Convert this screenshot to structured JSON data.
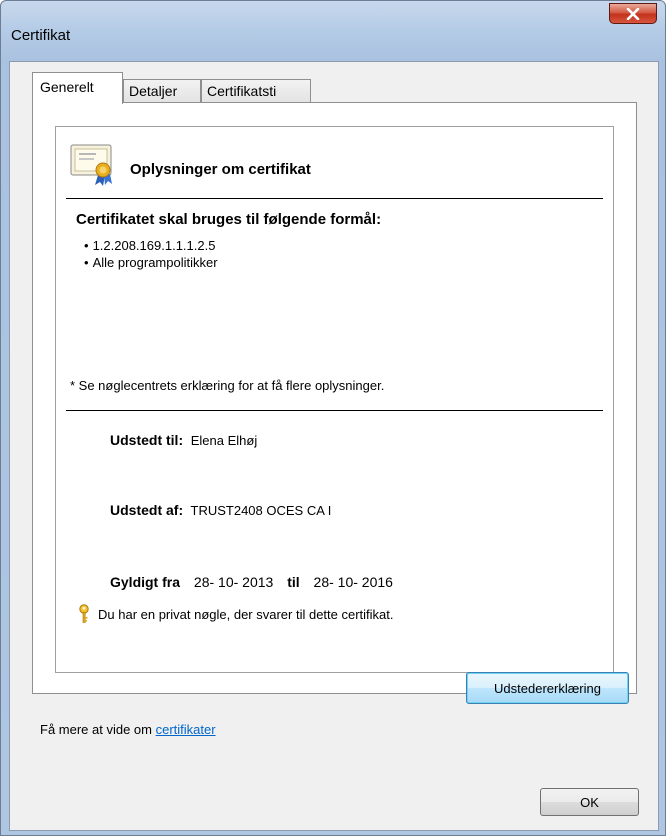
{
  "window": {
    "title": "Certifikat"
  },
  "tabs": [
    {
      "label": "Generelt",
      "active": true
    },
    {
      "label": "Detaljer",
      "active": false
    },
    {
      "label": "Certifikatsti",
      "active": false
    }
  ],
  "general": {
    "heading": "Oplysninger om certifikat",
    "purpose_title": "Certifikatet skal bruges til følgende formål:",
    "purposes": [
      "1.2.208.169.1.1.1.2.5",
      "Alle programpolitikker"
    ],
    "note": "* Se nøglecentrets erklæring for at få flere oplysninger.",
    "issued_to_label": "Udstedt til:",
    "issued_to_value": "Elena Elhøj",
    "issued_by_label": "Udstedt af:",
    "issued_by_value": "TRUST2408 OCES CA I",
    "valid_from_label": "Gyldigt fra",
    "valid_from_value": "28- 10- 2013",
    "valid_to_label": "til",
    "valid_to_value": "28- 10- 2016",
    "private_key_text": "Du har en privat nøgle, der svarer til dette certifikat."
  },
  "buttons": {
    "issuer_statement": "Udstedererklæring",
    "ok": "OK"
  },
  "learn_more": {
    "prefix": "Få mere at vide om ",
    "link": "certifikater"
  },
  "icons": {
    "close": "close-icon",
    "certificate": "certificate-icon",
    "key": "key-icon"
  },
  "colors": {
    "link": "#0066cc",
    "close_button": "#c3321c",
    "focused_button_border": "#3c7fb1"
  }
}
